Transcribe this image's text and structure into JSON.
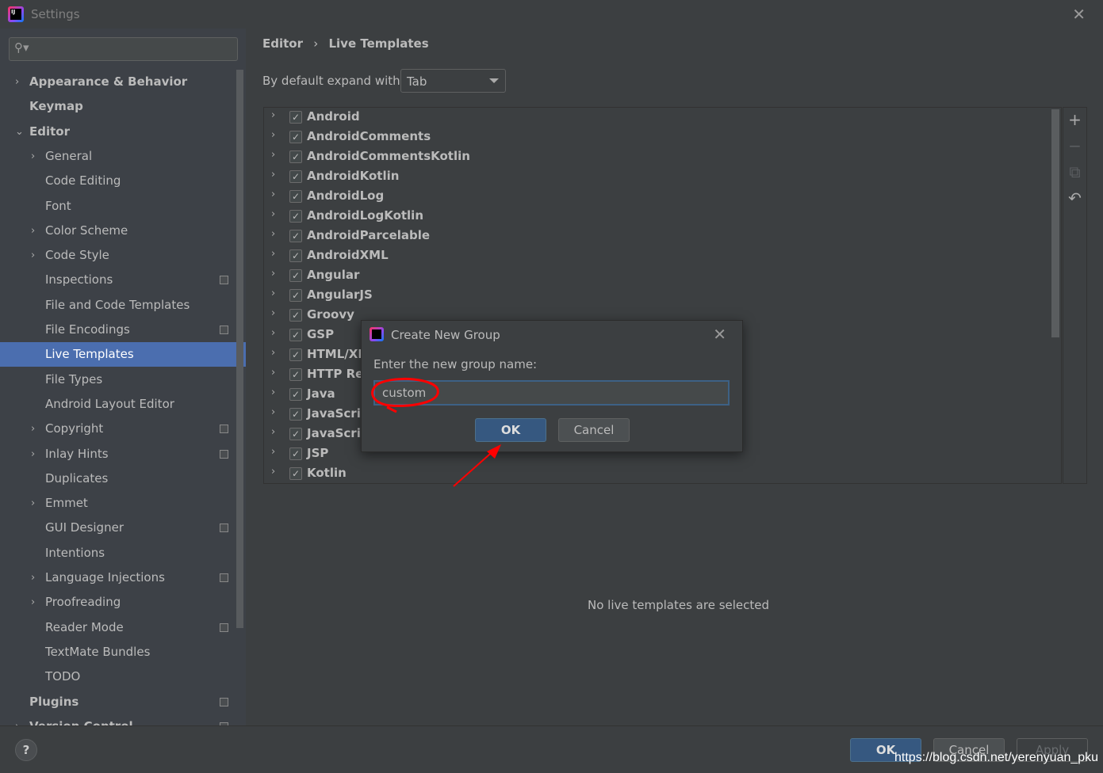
{
  "window": {
    "title": "Settings"
  },
  "sidebar": {
    "search_placeholder": "",
    "items": [
      {
        "label": "Appearance & Behavior",
        "level": 0,
        "chevron": "right",
        "bold": true
      },
      {
        "label": "Keymap",
        "level": 0,
        "bold": true
      },
      {
        "label": "Editor",
        "level": 0,
        "chevron": "down",
        "bold": true
      },
      {
        "label": "General",
        "level": 1,
        "chevron": "right"
      },
      {
        "label": "Code Editing",
        "level": 1
      },
      {
        "label": "Font",
        "level": 1
      },
      {
        "label": "Color Scheme",
        "level": 1,
        "chevron": "right"
      },
      {
        "label": "Code Style",
        "level": 1,
        "chevron": "right"
      },
      {
        "label": "Inspections",
        "level": 1,
        "project": true
      },
      {
        "label": "File and Code Templates",
        "level": 1
      },
      {
        "label": "File Encodings",
        "level": 1,
        "project": true
      },
      {
        "label": "Live Templates",
        "level": 1,
        "selected": true
      },
      {
        "label": "File Types",
        "level": 1
      },
      {
        "label": "Android Layout Editor",
        "level": 1
      },
      {
        "label": "Copyright",
        "level": 1,
        "chevron": "right",
        "project": true
      },
      {
        "label": "Inlay Hints",
        "level": 1,
        "chevron": "right",
        "project": true
      },
      {
        "label": "Duplicates",
        "level": 1
      },
      {
        "label": "Emmet",
        "level": 1,
        "chevron": "right"
      },
      {
        "label": "GUI Designer",
        "level": 1,
        "project": true
      },
      {
        "label": "Intentions",
        "level": 1
      },
      {
        "label": "Language Injections",
        "level": 1,
        "chevron": "right",
        "project": true
      },
      {
        "label": "Proofreading",
        "level": 1,
        "chevron": "right"
      },
      {
        "label": "Reader Mode",
        "level": 1,
        "project": true
      },
      {
        "label": "TextMate Bundles",
        "level": 1
      },
      {
        "label": "TODO",
        "level": 1
      },
      {
        "label": "Plugins",
        "level": 0,
        "bold": true,
        "project": true
      },
      {
        "label": "Version Control",
        "level": 0,
        "chevron": "right",
        "bold": true,
        "project": true
      }
    ]
  },
  "main": {
    "breadcrumb": [
      "Editor",
      "Live Templates"
    ],
    "breadcrumb_sep": "›",
    "expand_label": "By default expand with",
    "expand_value": "Tab",
    "templates": [
      {
        "name": "Android",
        "checked": true
      },
      {
        "name": "AndroidComments",
        "checked": true
      },
      {
        "name": "AndroidCommentsKotlin",
        "checked": true
      },
      {
        "name": "AndroidKotlin",
        "checked": true
      },
      {
        "name": "AndroidLog",
        "checked": true
      },
      {
        "name": "AndroidLogKotlin",
        "checked": true
      },
      {
        "name": "AndroidParcelable",
        "checked": true
      },
      {
        "name": "AndroidXML",
        "checked": true
      },
      {
        "name": "Angular",
        "checked": true
      },
      {
        "name": "AngularJS",
        "checked": true
      },
      {
        "name": "Groovy",
        "checked": true
      },
      {
        "name": "GSP",
        "checked": true
      },
      {
        "name": "HTML/XML",
        "checked": true
      },
      {
        "name": "HTTP Request",
        "checked": true
      },
      {
        "name": "Java",
        "checked": true
      },
      {
        "name": "JavaScript",
        "checked": true
      },
      {
        "name": "JavaScript Testing",
        "checked": true
      },
      {
        "name": "JSP",
        "checked": true
      },
      {
        "name": "Kotlin",
        "checked": true
      }
    ],
    "tools": [
      {
        "icon": "plus-icon",
        "glyph": "+"
      },
      {
        "icon": "minus-icon",
        "glyph": "−",
        "disabled": true
      },
      {
        "icon": "copy-icon",
        "glyph": "⧉",
        "disabled": true
      },
      {
        "icon": "undo-icon",
        "glyph": "↶"
      }
    ],
    "empty_text": "No live templates are selected"
  },
  "dialog": {
    "title": "Create New Group",
    "prompt": "Enter the new group name:",
    "input_value": "custom",
    "ok_label": "OK",
    "cancel_label": "Cancel"
  },
  "footer": {
    "help": "?",
    "ok_label": "OK",
    "cancel_label": "Cancel",
    "apply_label": "Apply",
    "watermark": "https://blog.csdn.net/yerenyuan_pku"
  },
  "colors": {
    "selection": "#4b6eaf",
    "primary_button": "#365880",
    "annotation": "#ff0000"
  }
}
